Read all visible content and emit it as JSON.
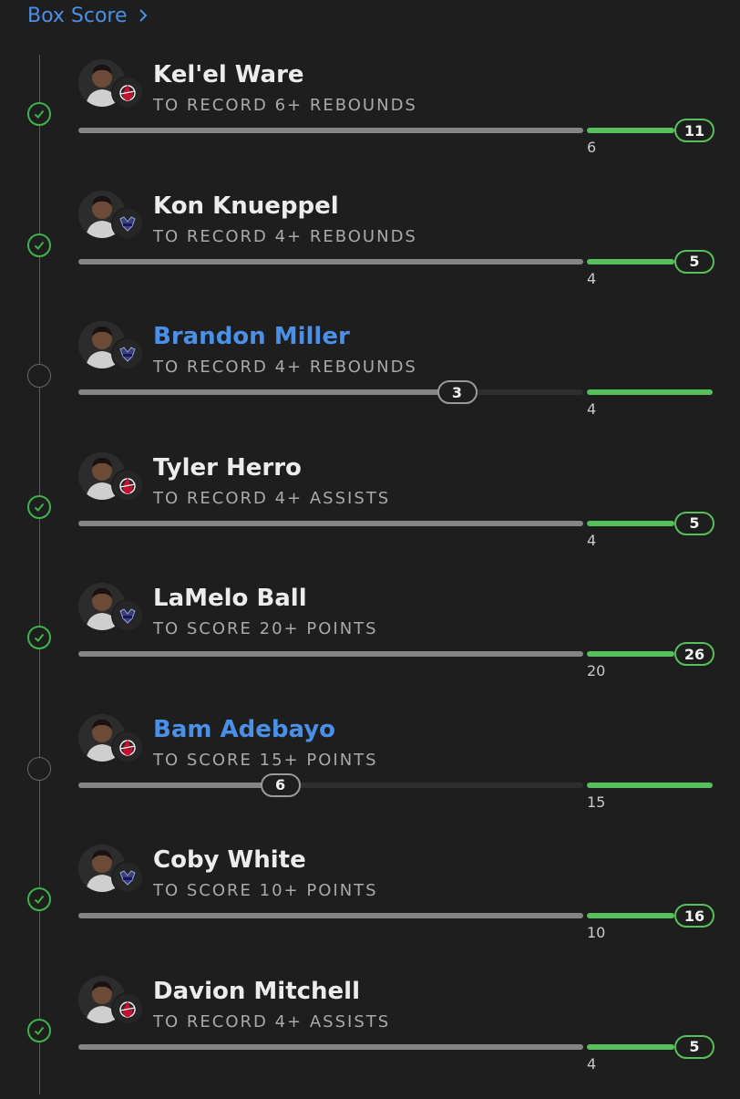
{
  "header": {
    "title": "Box Score"
  },
  "colors": {
    "accent": "#4a90e8",
    "hit": "#57c05a",
    "track": "#2e2e2e",
    "progress": "#858585"
  },
  "legs": [
    {
      "player": "Kel'el Ware",
      "team_icon": "heat-logo-icon",
      "desc": "TO RECORD 6+ REBOUNDS",
      "threshold": 6,
      "actual": 11,
      "status": "hit",
      "name_link": false
    },
    {
      "player": "Kon Knueppel",
      "team_icon": "hornets-logo-icon",
      "desc": "TO RECORD 4+ REBOUNDS",
      "threshold": 4,
      "actual": 5,
      "status": "hit",
      "name_link": false
    },
    {
      "player": "Brandon Miller",
      "team_icon": "hornets-logo-icon",
      "desc": "TO RECORD 4+ REBOUNDS",
      "threshold": 4,
      "actual": 3,
      "status": "pending",
      "name_link": true
    },
    {
      "player": "Tyler Herro",
      "team_icon": "heat-logo-icon",
      "desc": "TO RECORD 4+ ASSISTS",
      "threshold": 4,
      "actual": 5,
      "status": "hit",
      "name_link": false
    },
    {
      "player": "LaMelo Ball",
      "team_icon": "hornets-logo-icon",
      "desc": "TO SCORE 20+ POINTS",
      "threshold": 20,
      "actual": 26,
      "status": "hit",
      "name_link": false
    },
    {
      "player": "Bam Adebayo",
      "team_icon": "heat-logo-icon",
      "desc": "TO SCORE 15+ POINTS",
      "threshold": 15,
      "actual": 6,
      "status": "pending",
      "name_link": true
    },
    {
      "player": "Coby White",
      "team_icon": "hornets-logo-icon",
      "desc": "TO SCORE 10+ POINTS",
      "threshold": 10,
      "actual": 16,
      "status": "hit",
      "name_link": false
    },
    {
      "player": "Davion Mitchell",
      "team_icon": "heat-logo-icon",
      "desc": "TO RECORD 4+ ASSISTS",
      "threshold": 4,
      "actual": 5,
      "status": "hit",
      "name_link": false
    }
  ]
}
